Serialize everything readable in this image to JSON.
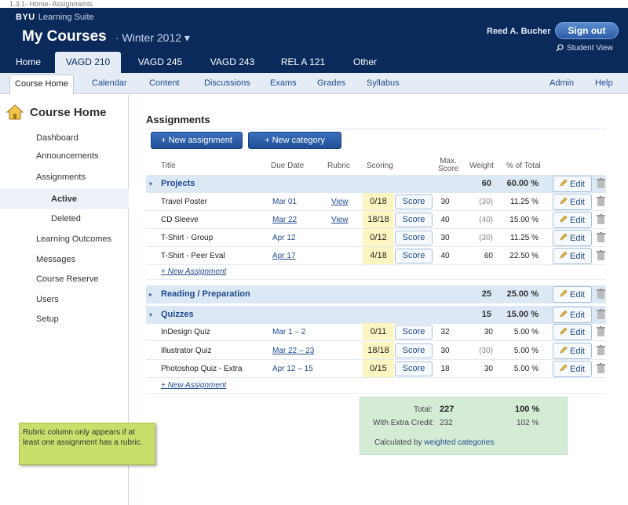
{
  "caption": "1.3.1- Home- Assignments",
  "header": {
    "brand_bold": "BYU",
    "brand_rest": "Learning Suite",
    "title": "My Courses",
    "term": "· Winter 2012 ▾",
    "user_name": "Reed A. Bucher",
    "signout_label": "Sign out",
    "student_view_label": "Student View"
  },
  "tabs": [
    "Home",
    "VAGD 210",
    "VAGD 245",
    "VAGD 243",
    "REL A 121",
    "Other"
  ],
  "subnav": {
    "items": [
      "Course Home",
      "Calendar",
      "Content",
      "Discussions",
      "Exams",
      "Grades",
      "Syllabus"
    ],
    "right": [
      "Admin",
      "Help"
    ]
  },
  "sidebar": {
    "title": "Course Home",
    "items": [
      "Dashboard",
      "Announcements",
      "Assignments",
      "Active",
      "Deleted",
      "Learning Outcomes",
      "Messages",
      "Course Reserve",
      "Users",
      "Setup"
    ]
  },
  "note": "Rubric column only appears if at least one assignment has a rubric.",
  "main": {
    "heading": "Assignments",
    "new_assignment_label": "+ New assignment",
    "new_category_label": "+ New category",
    "columns": {
      "title": "Title",
      "due": "Due Date",
      "rubric": "Rubric",
      "scoring": "Scoring",
      "max_score": "Max. Score",
      "weight": "Weight",
      "pct": "% of Total"
    },
    "edit_label": "Edit",
    "score_label": "Score",
    "new_assignment_link": "New Assignment",
    "categories": [
      {
        "name": "Projects",
        "weight": "60",
        "pct": "60.00 %",
        "items": [
          {
            "title": "Travel Poster",
            "due": "Mar 01",
            "rubric": "View",
            "scoring": "0/18",
            "max": "30",
            "weight": "(30)",
            "pct": "11.25 %"
          },
          {
            "title": "CD Sleeve",
            "due": "Mar 22",
            "rubric": "View",
            "scoring": "18/18",
            "max": "40",
            "weight": "(40)",
            "pct": "15.00 %"
          },
          {
            "title": "T-Shirt - Group",
            "due": "Apr 12",
            "rubric": "",
            "scoring": "0/12",
            "max": "30",
            "weight": "(30)",
            "pct": "11.25 %"
          },
          {
            "title": "T-Shirt - Peer Eval",
            "due": "Apr 17",
            "rubric": "",
            "scoring": "4/18",
            "max": "40",
            "weight": "60",
            "pct": "22.50 %"
          }
        ]
      },
      {
        "name": "Reading / Preparation",
        "weight": "25",
        "pct": "25.00 %",
        "items": []
      },
      {
        "name": "Quizzes",
        "weight": "15",
        "pct": "15.00 %",
        "items": [
          {
            "title": "InDesign Quiz",
            "due": "Mar 1 – 2",
            "rubric": "",
            "scoring": "0/11",
            "max": "32",
            "weight": "30",
            "pct": "5.00 %"
          },
          {
            "title": "Illustrator Quiz",
            "due": "Mar 22 – 23",
            "rubric": "",
            "scoring": "18/18",
            "max": "30",
            "weight": "(30)",
            "pct": "5.00 %"
          },
          {
            "title": "Photoshop Quiz - Extra",
            "due": "Apr 12 – 15",
            "rubric": "",
            "scoring": "0/15",
            "max": "18",
            "weight": "30",
            "pct": "5.00 %"
          }
        ]
      }
    ],
    "totals": {
      "total_label": "Total:",
      "total_value": "227",
      "total_pct": "100 %",
      "extra_label": "With Extra Credit:",
      "extra_value": "232",
      "extra_pct": "102 %",
      "calc_prefix": "Calculated by",
      "calc_link": "weighted categories"
    }
  }
}
